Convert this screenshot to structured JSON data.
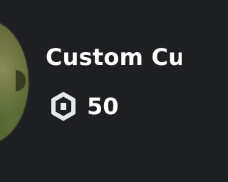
{
  "item": {
    "name": "Custom Cu",
    "price": "50",
    "currency_icon": "robux-icon",
    "thumbnail_icon": "item-thumbnail"
  },
  "colors": {
    "background": "#1e1f22",
    "text": "#ffffff",
    "icon": "#e6e7ea"
  }
}
